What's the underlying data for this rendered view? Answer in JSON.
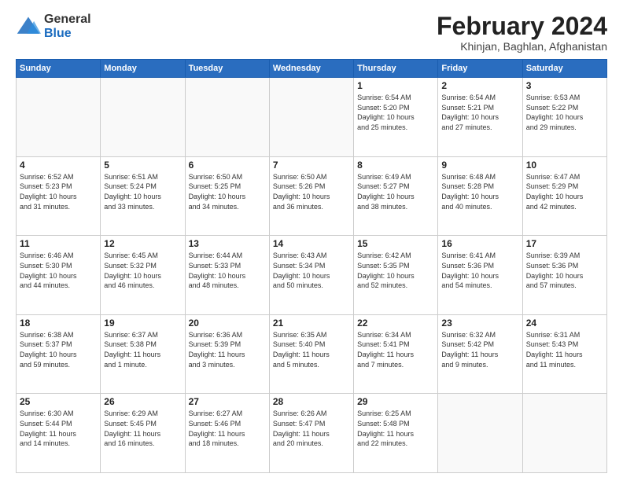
{
  "logo": {
    "general": "General",
    "blue": "Blue"
  },
  "title": "February 2024",
  "location": "Khinjan, Baghlan, Afghanistan",
  "days_of_week": [
    "Sunday",
    "Monday",
    "Tuesday",
    "Wednesday",
    "Thursday",
    "Friday",
    "Saturday"
  ],
  "weeks": [
    [
      {
        "day": "",
        "info": ""
      },
      {
        "day": "",
        "info": ""
      },
      {
        "day": "",
        "info": ""
      },
      {
        "day": "",
        "info": ""
      },
      {
        "day": "1",
        "info": "Sunrise: 6:54 AM\nSunset: 5:20 PM\nDaylight: 10 hours\nand 25 minutes."
      },
      {
        "day": "2",
        "info": "Sunrise: 6:54 AM\nSunset: 5:21 PM\nDaylight: 10 hours\nand 27 minutes."
      },
      {
        "day": "3",
        "info": "Sunrise: 6:53 AM\nSunset: 5:22 PM\nDaylight: 10 hours\nand 29 minutes."
      }
    ],
    [
      {
        "day": "4",
        "info": "Sunrise: 6:52 AM\nSunset: 5:23 PM\nDaylight: 10 hours\nand 31 minutes."
      },
      {
        "day": "5",
        "info": "Sunrise: 6:51 AM\nSunset: 5:24 PM\nDaylight: 10 hours\nand 33 minutes."
      },
      {
        "day": "6",
        "info": "Sunrise: 6:50 AM\nSunset: 5:25 PM\nDaylight: 10 hours\nand 34 minutes."
      },
      {
        "day": "7",
        "info": "Sunrise: 6:50 AM\nSunset: 5:26 PM\nDaylight: 10 hours\nand 36 minutes."
      },
      {
        "day": "8",
        "info": "Sunrise: 6:49 AM\nSunset: 5:27 PM\nDaylight: 10 hours\nand 38 minutes."
      },
      {
        "day": "9",
        "info": "Sunrise: 6:48 AM\nSunset: 5:28 PM\nDaylight: 10 hours\nand 40 minutes."
      },
      {
        "day": "10",
        "info": "Sunrise: 6:47 AM\nSunset: 5:29 PM\nDaylight: 10 hours\nand 42 minutes."
      }
    ],
    [
      {
        "day": "11",
        "info": "Sunrise: 6:46 AM\nSunset: 5:30 PM\nDaylight: 10 hours\nand 44 minutes."
      },
      {
        "day": "12",
        "info": "Sunrise: 6:45 AM\nSunset: 5:32 PM\nDaylight: 10 hours\nand 46 minutes."
      },
      {
        "day": "13",
        "info": "Sunrise: 6:44 AM\nSunset: 5:33 PM\nDaylight: 10 hours\nand 48 minutes."
      },
      {
        "day": "14",
        "info": "Sunrise: 6:43 AM\nSunset: 5:34 PM\nDaylight: 10 hours\nand 50 minutes."
      },
      {
        "day": "15",
        "info": "Sunrise: 6:42 AM\nSunset: 5:35 PM\nDaylight: 10 hours\nand 52 minutes."
      },
      {
        "day": "16",
        "info": "Sunrise: 6:41 AM\nSunset: 5:36 PM\nDaylight: 10 hours\nand 54 minutes."
      },
      {
        "day": "17",
        "info": "Sunrise: 6:39 AM\nSunset: 5:36 PM\nDaylight: 10 hours\nand 57 minutes."
      }
    ],
    [
      {
        "day": "18",
        "info": "Sunrise: 6:38 AM\nSunset: 5:37 PM\nDaylight: 10 hours\nand 59 minutes."
      },
      {
        "day": "19",
        "info": "Sunrise: 6:37 AM\nSunset: 5:38 PM\nDaylight: 11 hours\nand 1 minute."
      },
      {
        "day": "20",
        "info": "Sunrise: 6:36 AM\nSunset: 5:39 PM\nDaylight: 11 hours\nand 3 minutes."
      },
      {
        "day": "21",
        "info": "Sunrise: 6:35 AM\nSunset: 5:40 PM\nDaylight: 11 hours\nand 5 minutes."
      },
      {
        "day": "22",
        "info": "Sunrise: 6:34 AM\nSunset: 5:41 PM\nDaylight: 11 hours\nand 7 minutes."
      },
      {
        "day": "23",
        "info": "Sunrise: 6:32 AM\nSunset: 5:42 PM\nDaylight: 11 hours\nand 9 minutes."
      },
      {
        "day": "24",
        "info": "Sunrise: 6:31 AM\nSunset: 5:43 PM\nDaylight: 11 hours\nand 11 minutes."
      }
    ],
    [
      {
        "day": "25",
        "info": "Sunrise: 6:30 AM\nSunset: 5:44 PM\nDaylight: 11 hours\nand 14 minutes."
      },
      {
        "day": "26",
        "info": "Sunrise: 6:29 AM\nSunset: 5:45 PM\nDaylight: 11 hours\nand 16 minutes."
      },
      {
        "day": "27",
        "info": "Sunrise: 6:27 AM\nSunset: 5:46 PM\nDaylight: 11 hours\nand 18 minutes."
      },
      {
        "day": "28",
        "info": "Sunrise: 6:26 AM\nSunset: 5:47 PM\nDaylight: 11 hours\nand 20 minutes."
      },
      {
        "day": "29",
        "info": "Sunrise: 6:25 AM\nSunset: 5:48 PM\nDaylight: 11 hours\nand 22 minutes."
      },
      {
        "day": "",
        "info": ""
      },
      {
        "day": "",
        "info": ""
      }
    ]
  ]
}
